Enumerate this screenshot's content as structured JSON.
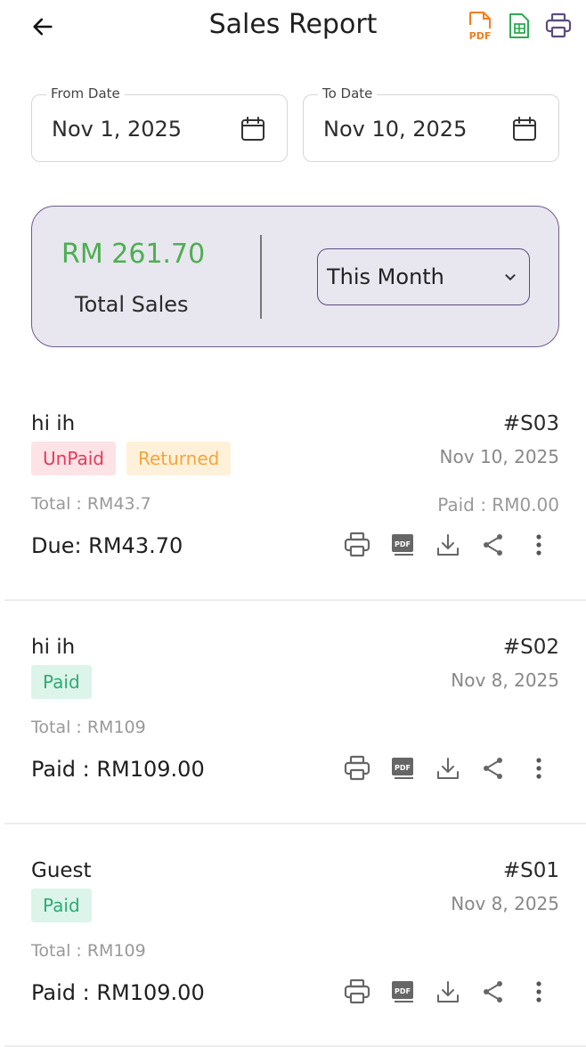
{
  "header": {
    "title": "Sales Report",
    "back_icon": "arrow-left-icon",
    "actions": [
      {
        "name": "pdf-export-icon",
        "color": "#f57c1f",
        "label": "PDF"
      },
      {
        "name": "sheet-export-icon",
        "color": "#2eaa55"
      },
      {
        "name": "print-icon",
        "color": "#5e4b7e"
      }
    ]
  },
  "filters": {
    "from_label": "From Date",
    "from_value": "Nov 1, 2025",
    "to_label": "To Date",
    "to_value": "Nov 10, 2025"
  },
  "summary": {
    "amount": "RM 261.70",
    "label": "Total Sales",
    "period": "This Month",
    "amount_color": "#4caf50",
    "card_bg": "#e8e6ef",
    "card_border": "#6f5a8e"
  },
  "sales": [
    {
      "customer": "hi ih",
      "invoice": "#S03",
      "badges": [
        "UnPaid",
        "Returned"
      ],
      "date": "Nov 10, 2025",
      "total": "Total : RM43.7",
      "paid": "Paid : RM0.00",
      "due": "Due: RM43.70"
    },
    {
      "customer": "hi ih",
      "invoice": "#S02",
      "badges": [
        "Paid"
      ],
      "date": "Nov 8, 2025",
      "total": "Total : RM109",
      "due": "Paid : RM109.00"
    },
    {
      "customer": "Guest",
      "invoice": "#S01",
      "badges": [
        "Paid"
      ],
      "date": "Nov 8, 2025",
      "total": "Total : RM109",
      "due": "Paid : RM109.00"
    }
  ],
  "row_action_icons": [
    "print-icon",
    "pdf-icon",
    "download-icon",
    "share-icon",
    "more-vert-icon"
  ]
}
